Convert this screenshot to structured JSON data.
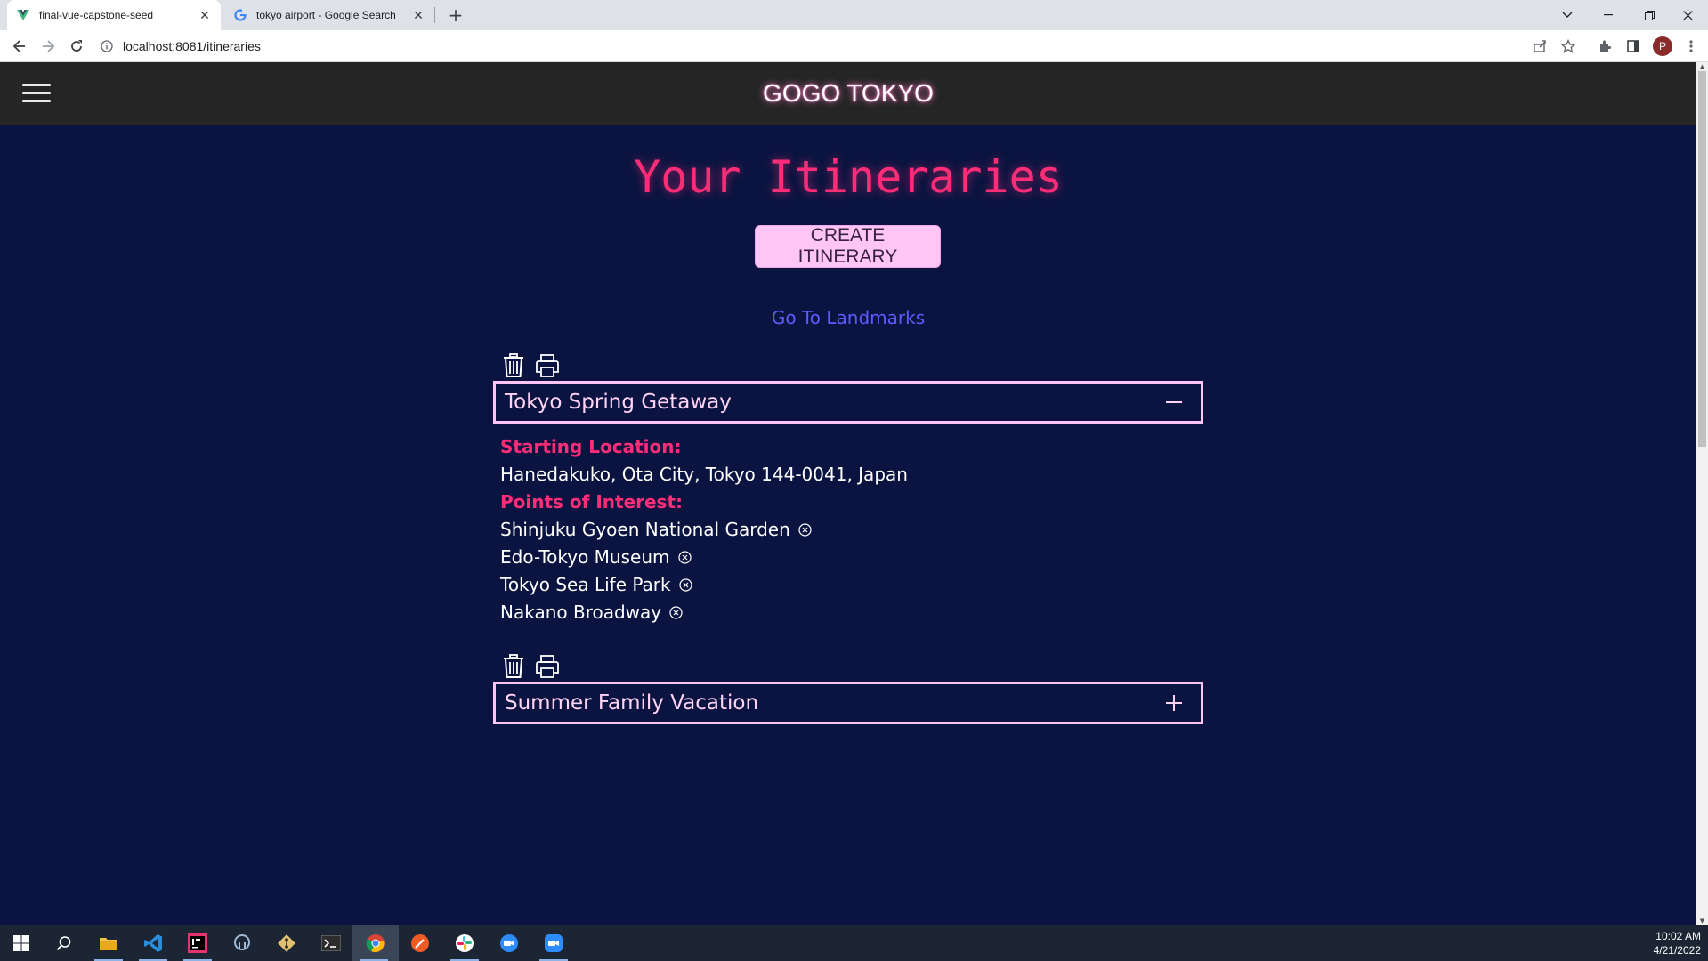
{
  "browser": {
    "tabs": [
      {
        "title": "final-vue-capstone-seed",
        "favicon": "vue-logo-icon",
        "active": true
      },
      {
        "title": "tokyo airport - Google Search",
        "favicon": "google-g-icon",
        "active": false
      }
    ],
    "url": "localhost:8081/itineraries",
    "profile_initial": "P"
  },
  "app": {
    "brand": "GOGO TOKYO",
    "page_title": "Your Itineraries",
    "create_button": "CREATE ITINERARY",
    "landmarks_link": "Go To Landmarks",
    "colors": {
      "background": "#0b1440",
      "header": "#252525",
      "accent_pink": "#ff2d78",
      "button_bg": "#ffc6f5",
      "link_blue": "#5b5bff"
    },
    "itineraries": [
      {
        "name": "Tokyo Spring Getaway",
        "expanded": true,
        "toggle_icon": "minus-icon",
        "starting_location_label": "Starting Location:",
        "starting_location": "Hanedakuko, Ota City, Tokyo 144-0041, Japan",
        "poi_label": "Points of Interest:",
        "points_of_interest": [
          "Shinjuku Gyoen National Garden",
          "Edo-Tokyo Museum",
          "Tokyo Sea Life Park",
          "Nakano Broadway"
        ]
      },
      {
        "name": "Summer Family Vacation",
        "expanded": false,
        "toggle_icon": "plus-icon"
      }
    ]
  },
  "taskbar": {
    "items": [
      "windows-start-icon",
      "search-icon",
      "file-explorer-icon",
      "vscode-icon",
      "intellij-icon",
      "postgres-icon",
      "git-icon",
      "terminal-icon",
      "chrome-icon",
      "postman-icon",
      "slack-icon",
      "zoom-icon",
      "zoom-meeting-icon"
    ],
    "time": "10:02 AM",
    "date": "4/21/2022"
  }
}
